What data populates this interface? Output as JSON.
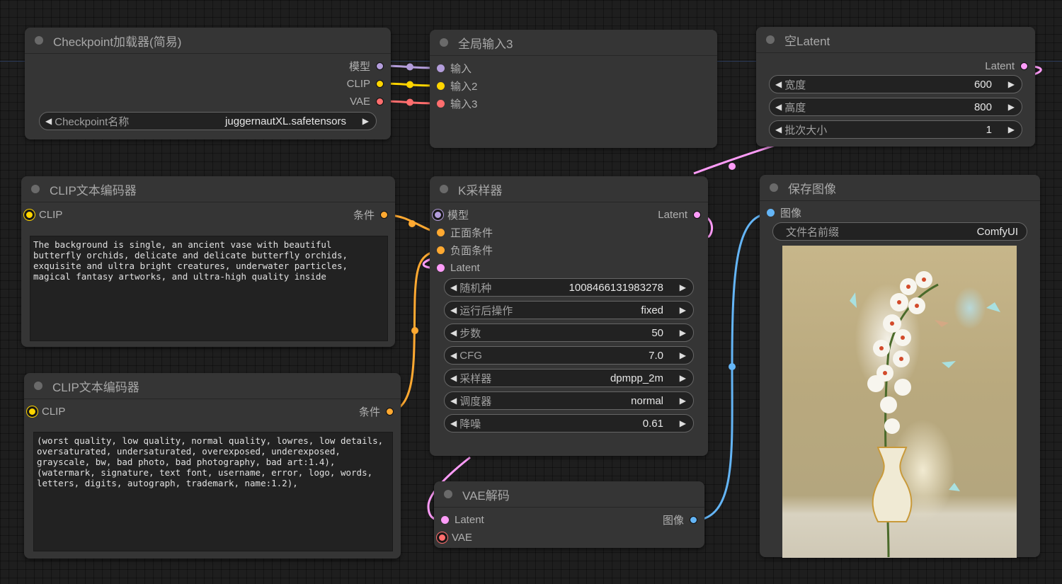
{
  "colors": {
    "model": "#b39ddb",
    "clip": "#ffd500",
    "vae": "#ff6e6e",
    "conditioning": "#ffa931",
    "latent": "#ff9cf9",
    "image": "#64b5f6"
  },
  "nodes": {
    "checkpoint_loader": {
      "title": "Checkpoint加载器(简易)",
      "outputs": [
        "模型",
        "CLIP",
        "VAE"
      ],
      "widget": {
        "label": "Checkpoint名称",
        "value": "juggernautXL.safetensors"
      }
    },
    "global_input": {
      "title": "全局输入3",
      "inputs": [
        "输入",
        "输入2",
        "输入3"
      ]
    },
    "empty_latent": {
      "title": "空Latent",
      "output": "Latent",
      "widgets": [
        {
          "label": "宽度",
          "value": "600"
        },
        {
          "label": "高度",
          "value": "800"
        },
        {
          "label": "批次大小",
          "value": "1"
        }
      ]
    },
    "clip_encoder_positive": {
      "title": "CLIP文本编码器",
      "input": "CLIP",
      "output": "条件",
      "text": "The background is single, an ancient vase with beautiful butterfly orchids, delicate and delicate butterfly orchids, exquisite and ultra bright creatures, underwater particles, magical fantasy artworks, and ultra-high quality inside"
    },
    "clip_encoder_negative": {
      "title": "CLIP文本编码器",
      "input": "CLIP",
      "output": "条件",
      "text": "(worst quality, low quality, normal quality, lowres, low details, oversaturated, undersaturated, overexposed, underexposed, grayscale, bw, bad photo, bad photography, bad art:1.4), (watermark, signature, text font, username, error, logo, words, letters, digits, autograph, trademark, name:1.2),"
    },
    "ksampler": {
      "title": "K采样器",
      "inputs": [
        "模型",
        "正面条件",
        "负面条件",
        "Latent"
      ],
      "output": "Latent",
      "widgets": [
        {
          "label": "随机种",
          "value": "1008466131983278"
        },
        {
          "label": "运行后操作",
          "value": "fixed"
        },
        {
          "label": "步数",
          "value": "50"
        },
        {
          "label": "CFG",
          "value": "7.0"
        },
        {
          "label": "采样器",
          "value": "dpmpp_2m"
        },
        {
          "label": "调度器",
          "value": "normal"
        },
        {
          "label": "降噪",
          "value": "0.61"
        }
      ]
    },
    "vae_decode": {
      "title": "VAE解码",
      "inputs": [
        "Latent",
        "VAE"
      ],
      "output": "图像"
    },
    "save_image": {
      "title": "保存图像",
      "input": "图像",
      "widget": {
        "label": "文件名前缀",
        "value": "ComfyUI"
      },
      "preview_alt": "ancient vase with white butterfly orchids and butterflies"
    }
  },
  "arrows": {
    "left": "◀",
    "right": "▶"
  }
}
